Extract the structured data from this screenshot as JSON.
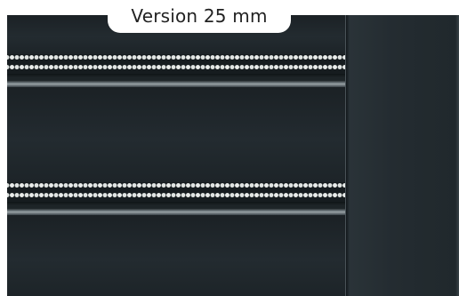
{
  "badge": {
    "label": "Version 25 mm"
  },
  "colors": {
    "shutter": "#1d2427",
    "perforations": "#e9ecea",
    "badge_background": "#ffffff",
    "badge_text": "#222222"
  }
}
